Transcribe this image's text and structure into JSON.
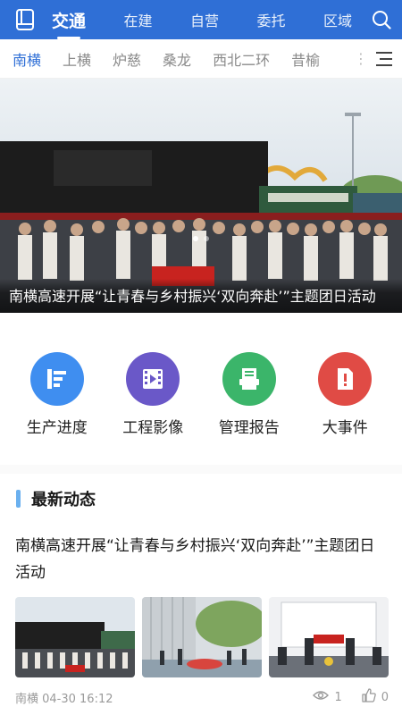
{
  "header": {
    "tabs": [
      {
        "label": "交通",
        "active": true
      },
      {
        "label": "在建",
        "active": false
      },
      {
        "label": "自营",
        "active": false
      },
      {
        "label": "委托",
        "active": false
      },
      {
        "label": "区域",
        "active": false
      }
    ],
    "icons": {
      "left": "book-icon",
      "right": "search-icon"
    },
    "color": "#2f6fd6"
  },
  "subtabs": {
    "items": [
      {
        "label": "南横",
        "active": true
      },
      {
        "label": "上横",
        "active": false
      },
      {
        "label": "炉慈",
        "active": false
      },
      {
        "label": "桑龙",
        "active": false
      },
      {
        "label": "西北二环",
        "active": false
      },
      {
        "label": "昔榆",
        "active": false
      }
    ],
    "more": "⋮",
    "menu_icon": "menu-icon"
  },
  "banner": {
    "caption": "南横高速开展“让青春与乡村振兴‘双向奔赴’”主题团日活动",
    "slides": 2,
    "active_slide": 0
  },
  "actions": [
    {
      "label": "生产进度",
      "icon": "progress-icon",
      "color": "#3f8ef0"
    },
    {
      "label": "工程影像",
      "icon": "film-icon",
      "color": "#6a58c8"
    },
    {
      "label": "管理报告",
      "icon": "report-icon",
      "color": "#3bb56a"
    },
    {
      "label": "大事件",
      "icon": "alert-doc-icon",
      "color": "#e04b45"
    }
  ],
  "news_section": {
    "title": "最新动态",
    "item": {
      "headline": "南横高速开展“让青春与乡村振兴‘双向奔赴’”主题团日活动",
      "source_time": "南横 04-30 16:12",
      "views": "1",
      "likes": "0"
    }
  }
}
